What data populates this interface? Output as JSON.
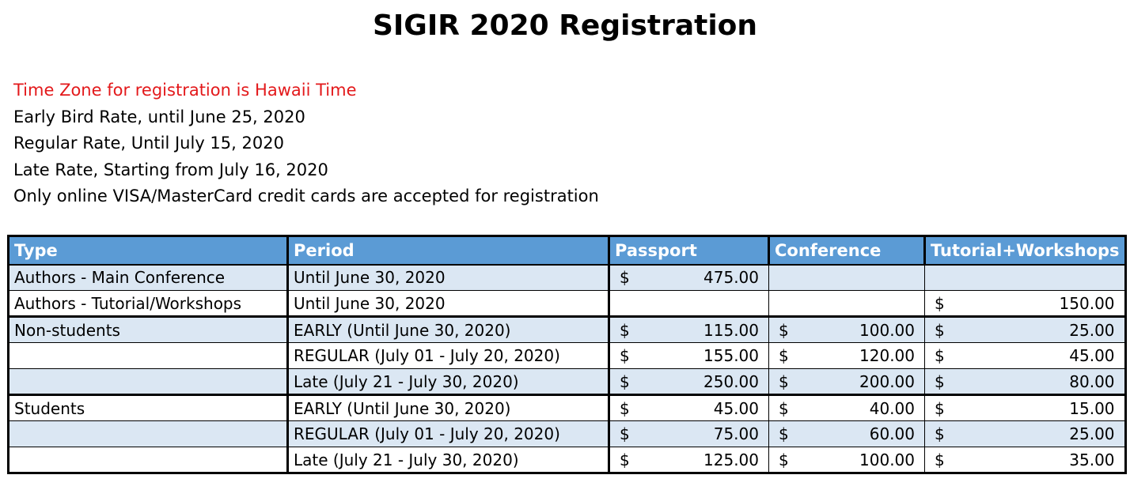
{
  "title": "SIGIR 2020 Registration",
  "notes": [
    "Time Zone for registration is Hawaii Time",
    "Early Bird Rate, until June 25, 2020",
    "Regular Rate, Until July 15, 2020",
    "Late Rate, Starting from July 16, 2020",
    "Only online VISA/MasterCard credit cards are accepted for registration"
  ],
  "colors": {
    "header_bg": "#5b9bd5",
    "row_shade": "#dbe7f3",
    "notice_red": "#e3191b"
  },
  "table": {
    "headers": [
      "Type",
      "Period",
      "Passport",
      "Conference",
      "Tutorial+Workshops"
    ],
    "currency": "$",
    "rows": [
      {
        "type": "Authors - Main Conference",
        "period": "Until June 30, 2020",
        "passport": "475.00",
        "conference": "",
        "tutorial": ""
      },
      {
        "type": "Authors - Tutorial/Workshops",
        "period": "Until June 30, 2020",
        "passport": "",
        "conference": "",
        "tutorial": "150.00"
      },
      {
        "type": "Non-students",
        "period": "EARLY (Until June 30, 2020)",
        "passport": "115.00",
        "conference": "100.00",
        "tutorial": "25.00"
      },
      {
        "type": "",
        "period": "REGULAR (July 01 - July 20, 2020)",
        "passport": "155.00",
        "conference": "120.00",
        "tutorial": "45.00"
      },
      {
        "type": "",
        "period": "Late (July 21 - July 30, 2020)",
        "passport": "250.00",
        "conference": "200.00",
        "tutorial": "80.00"
      },
      {
        "type": "Students",
        "period": "EARLY (Until June 30, 2020)",
        "passport": "45.00",
        "conference": "40.00",
        "tutorial": "15.00"
      },
      {
        "type": "",
        "period": "REGULAR (July 01 - July 20, 2020)",
        "passport": "75.00",
        "conference": "60.00",
        "tutorial": "25.00"
      },
      {
        "type": "",
        "period": "Late (July 21 - July 30, 2020)",
        "passport": "125.00",
        "conference": "100.00",
        "tutorial": "35.00"
      }
    ]
  }
}
